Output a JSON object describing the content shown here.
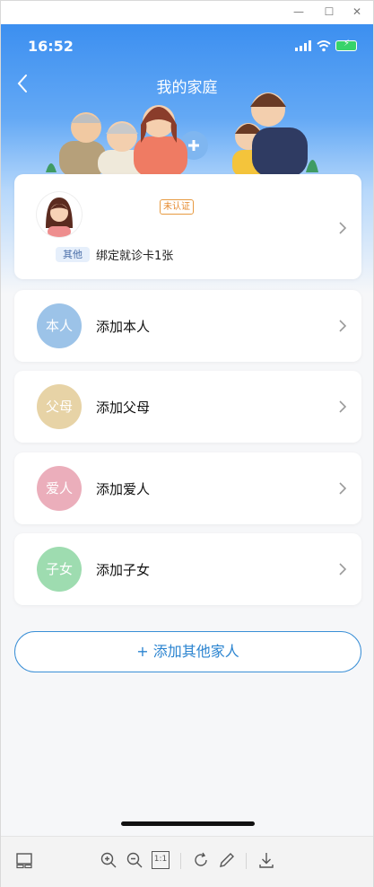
{
  "window": {
    "controls": {
      "minimize": "—",
      "maximize": "☐",
      "close": "✕"
    }
  },
  "status_bar": {
    "time": "16:52"
  },
  "nav": {
    "title": "我的家庭",
    "back_icon": "chevron-left-icon"
  },
  "profile": {
    "badge": "其他",
    "unverified": "未认证",
    "bound_cards": "绑定就诊卡1张"
  },
  "add_members": [
    {
      "circle": "本人",
      "label": "添加本人",
      "color": "#9cc3e8"
    },
    {
      "circle": "父母",
      "label": "添加父母",
      "color": "#e7d3a6"
    },
    {
      "circle": "爱人",
      "label": "添加爱人",
      "color": "#ebaebb"
    },
    {
      "circle": "子女",
      "label": "添加子女",
      "color": "#9edcb0"
    }
  ],
  "add_other": "+ 添加其他家人",
  "toolbar": {
    "icons": [
      "layout-icon",
      "zoom-in-icon",
      "zoom-out-icon",
      "actual-size-icon",
      "rotate-icon",
      "edit-icon",
      "download-icon"
    ],
    "actual_size_label": "1:1"
  }
}
